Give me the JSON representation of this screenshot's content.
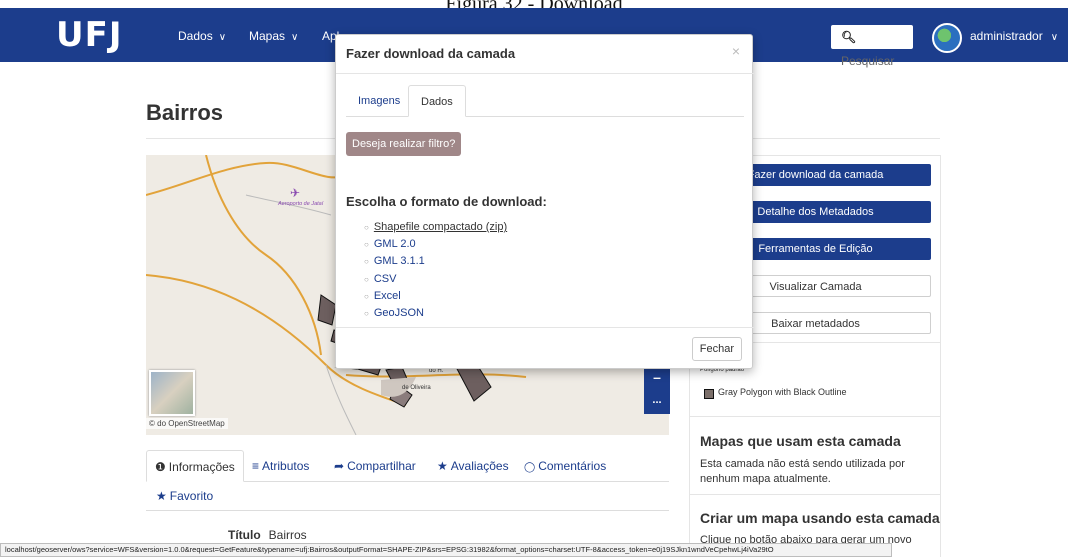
{
  "caption": "Figura 32 - Download",
  "navbar": {
    "logo": "UFJ",
    "items": [
      {
        "label": "Dados"
      },
      {
        "label": "Mapas"
      },
      {
        "label": "Apl"
      }
    ],
    "search_label": "Pesquisar",
    "user_label": "administrador",
    "brand_color": "#1c3d8c"
  },
  "page": {
    "title": "Bairros"
  },
  "map": {
    "labels": {
      "airport": "Aeroporto de Jataí",
      "neighborhood_1": "do H.",
      "neighborhood_2": "de Oliveira"
    },
    "attribution": "© do OpenStreetMap",
    "zoom_out": "–",
    "more": "..."
  },
  "info_tabs": [
    {
      "icon": "info-icon",
      "glyph": "❶",
      "label": "Informações"
    },
    {
      "icon": "list-icon",
      "glyph": "≡",
      "label": "Atributos"
    },
    {
      "icon": "share-icon",
      "glyph": "➦",
      "label": "Compartilhar"
    },
    {
      "icon": "star-icon",
      "glyph": "★",
      "label": "Avaliações"
    },
    {
      "icon": "comment-icon",
      "glyph": "◯",
      "label": "Comentários"
    }
  ],
  "favorite": {
    "glyph": "★",
    "label": "Favorito"
  },
  "details": {
    "titulo_label": "Título",
    "titulo_value": "Bairros"
  },
  "right_panel": {
    "buttons": [
      {
        "label": "Fazer download da camada",
        "style": "primary"
      },
      {
        "label": "Detalhe dos Metadados",
        "style": "primary"
      },
      {
        "label": "Ferramentas de Edição",
        "style": "primary"
      },
      {
        "label": "Visualizar Camada",
        "style": "outline"
      },
      {
        "label": "Baixar metadados",
        "style": "outline"
      }
    ],
    "legend_caption": "Polígono padrão",
    "legend_label": "Gray Polygon with Black Outline",
    "maps_heading": "Mapas que usam esta camada",
    "maps_text": "Esta camada não está sendo utilizada por nenhum mapa atualmente.",
    "create_heading": "Criar um mapa usando esta camada",
    "create_text": "Clique no botão abaixo para gerar um novo"
  },
  "modal": {
    "title": "Fazer download da camada",
    "close_glyph": "×",
    "tabs": [
      {
        "label": "Imagens"
      },
      {
        "label": "Dados"
      }
    ],
    "filter_button": "Deseja realizar filtro?",
    "format_heading": "Escolha o formato de download:",
    "formats": [
      "Shapefile compactado (zip)",
      "GML 2.0",
      "GML 3.1.1",
      "CSV",
      "Excel",
      "GeoJSON"
    ],
    "close_button": "Fechar"
  },
  "statusbar": {
    "url": "localhost/geoserver/ows?service=WFS&version=1.0.0&request=GetFeature&typename=ufj:Bairros&outputFormat=SHAPE-ZIP&srs=EPSG:31982&format_options=charset:UTF-8&access_token=e0j19SJkn1wndVeCpehwLj4iVa29tO"
  }
}
